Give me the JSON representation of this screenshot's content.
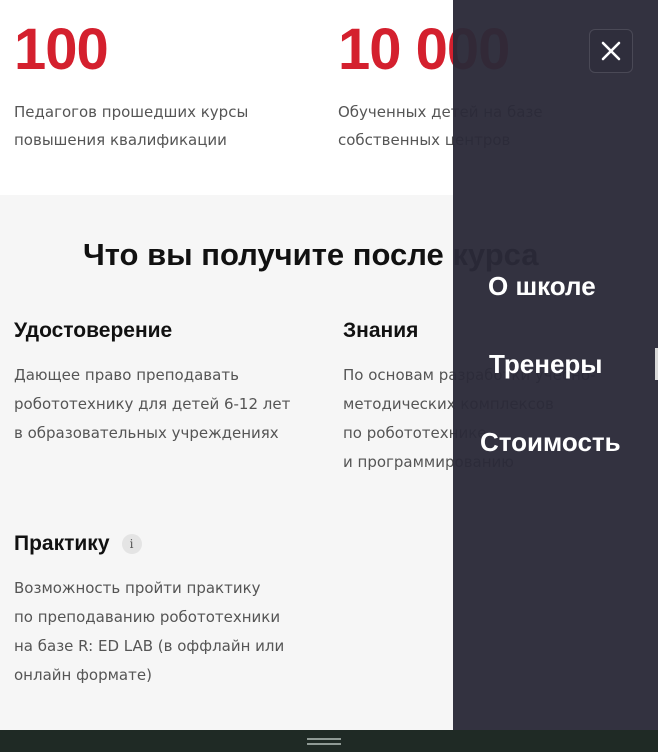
{
  "stats": [
    {
      "number": "100",
      "description": "Педагогов прошедших курсы повышения квалификации"
    },
    {
      "number": "10 000",
      "description": "Обученных детей на базе собственных центров"
    }
  ],
  "benefits_section": {
    "title": "Что вы получите после курса",
    "items": [
      {
        "title": "Удостоверение",
        "description": "Дающее право преподавать\nробототехнику для детей 6-12 лет\nв образовательных учреждениях"
      },
      {
        "title": "Знания",
        "description": "По основам разработки учебно-\nметодических комплексов\nпо робототехнике\nи программированию"
      },
      {
        "title": "Практику",
        "info_icon": "i",
        "description": "Возможность пройти практику\nпо преподаванию робототехники\nна базе R: ED LAB (в оффлайн или\nонлайн формате)"
      }
    ]
  },
  "menu": {
    "close_icon": "close-icon",
    "items": [
      {
        "label": "О школе"
      },
      {
        "label": "Тренеры"
      },
      {
        "label": "Стоимость"
      }
    ]
  },
  "colors": {
    "accent_red": "#d4202e",
    "overlay_bg": "#2b2a38",
    "section_bg": "#f6f6f6"
  }
}
